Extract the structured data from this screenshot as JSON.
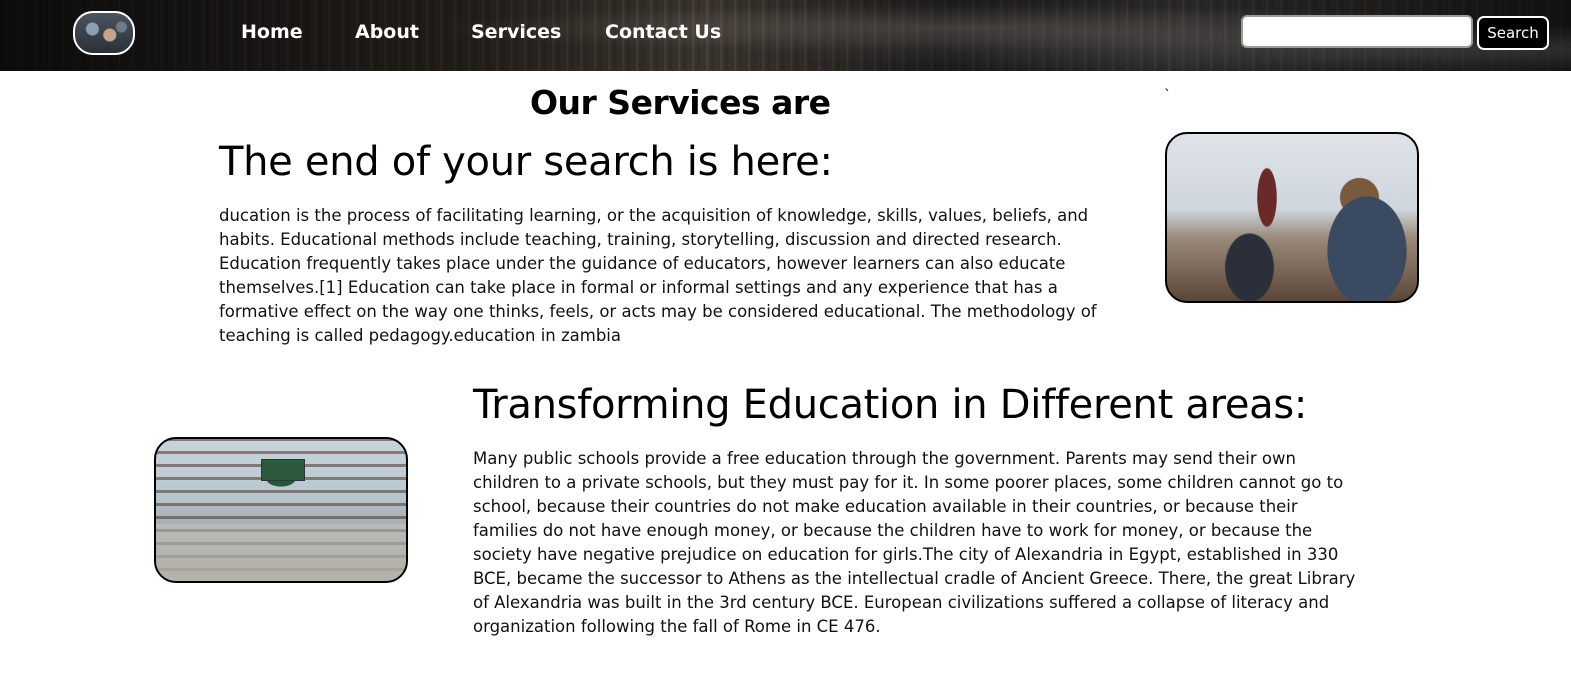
{
  "header": {
    "nav": [
      {
        "label": "Home"
      },
      {
        "label": "About"
      },
      {
        "label": "Services"
      },
      {
        "label": "Contact Us"
      }
    ],
    "search": {
      "value": "",
      "button_label": "Search"
    }
  },
  "main": {
    "page_title": "Our Services are",
    "stray_mark": "`",
    "section1": {
      "title": "The end of your search is here:",
      "text": "ducation is the process of facilitating learning, or the acquisition of knowledge, skills, values, beliefs, and habits. Educational methods include teaching, training, storytelling, discussion and directed research. Education frequently takes place under the guidance of educators, however learners can also educate themselves.[1] Education can take place in formal or informal settings and any experience that has a formative effect on the way one thinks, feels, or acts may be considered educational. The methodology of teaching is called pedagogy.education in zambia"
    },
    "section2": {
      "title": "Transforming Education in Different areas:",
      "text": "Many public schools provide a free education through the government. Parents may send their own children to a private schools, but they must pay for it. In some poorer places, some children cannot go to school, because their countries do not make education available in their countries, or because their families do not have enough money, or because the children have to work for money, or because the society have negative prejudice on education for girls.The city of Alexandria in Egypt, established in 330 BCE, became the successor to Athens as the intellectual cradle of Ancient Greece. There, the great Library of Alexandria was built in the 3rd century BCE. European civilizations suffered a collapse of literacy and organization following the fall of Rome in CE 476."
    }
  }
}
